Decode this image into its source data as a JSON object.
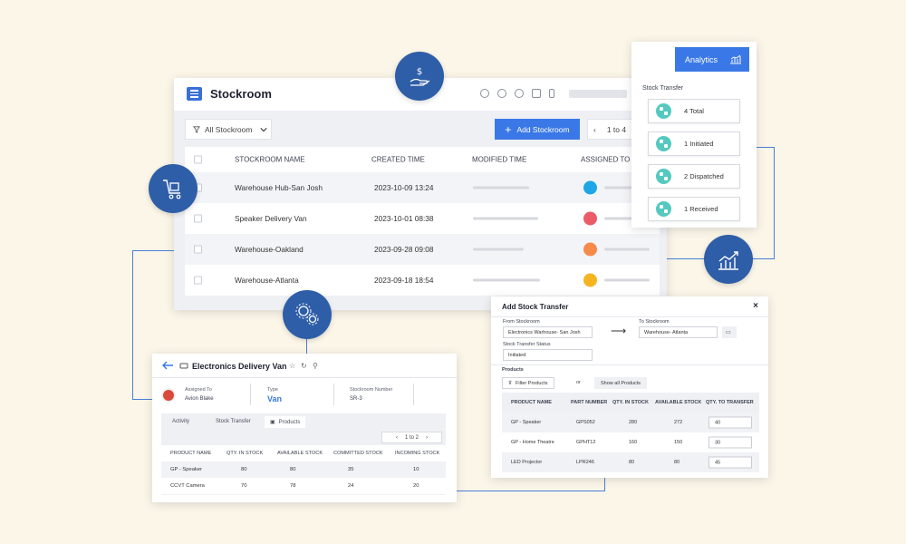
{
  "main": {
    "title": "Stockroom",
    "filter_label": "All Stockroom",
    "add_button": "Add Stockroom",
    "pager": "1 to 4",
    "columns": [
      "STOCKROOM NAME",
      "CREATED TIME",
      "MODIFIED TIME",
      "ASSIGNED TO"
    ],
    "rows": [
      {
        "name": "Warehouse Hub-San Josh",
        "created": "2023-10-09 13:24",
        "color": "#1ea7e4"
      },
      {
        "name": "Speaker Delivery Van",
        "created": "2023-10-01 08:38",
        "color": "#ec5b68"
      },
      {
        "name": "Warehouse-Oakland",
        "created": "2023-09-28 09:08",
        "color": "#f58a4b"
      },
      {
        "name": "Warehouse-Atlanta",
        "created": "2023-09-18 18:54",
        "color": "#f5b521"
      }
    ]
  },
  "transfer": {
    "analytics_button": "Analytics",
    "label": "Stock Transfer",
    "items": [
      "4 Total",
      "1 Initiated",
      "2 Dispatched",
      "1 Received"
    ]
  },
  "electronics": {
    "title": "Electronics Delivery Van",
    "assigned_label": "Assigned To",
    "assigned_value": "Avion Blake",
    "type_label": "Type",
    "type_value": "Van",
    "number_label": "Stockroom Number",
    "number_value": "SR-3",
    "tabs": [
      "Activity",
      "Stock Transfer",
      "Products"
    ],
    "pager": "1 to 2",
    "columns": [
      "PRODUCT NAME",
      "QTY. IN STOCK",
      "AVAILABLE STOCK",
      "COMMITTED STOCK",
      "INCOMING STOCK"
    ],
    "rows": [
      [
        "GP - Speaker",
        "80",
        "80",
        "35",
        "10"
      ],
      [
        "CCVT Camera",
        "70",
        "78",
        "24",
        "20"
      ]
    ]
  },
  "dialog": {
    "title": "Add Stock Transfer",
    "close": "×",
    "from_label": "From Stockroom",
    "from_value": "Electronics Warhouse- San Josh",
    "to_label": "To Stockroom",
    "to_value": "Warehouse- Atlanta",
    "status_label": "Stock Transfer Status",
    "status_value": "Initiated",
    "products_label": "Products",
    "filter_button": "Filter Products",
    "or": "or",
    "show_all": "Show all Products",
    "columns": [
      "PRODUCT NAME",
      "PART NUMBER",
      "QTY. IN STOCK",
      "AVAILABLE STOCK",
      "QTY. TO TRANSFER"
    ],
    "rows": [
      [
        "GP - Speaker",
        "GPS052",
        "280",
        "272",
        "40"
      ],
      [
        "GP - Home Theatre",
        "GPHT12",
        "160",
        "150",
        "30"
      ],
      [
        "LED Projector",
        "LPR246",
        "80",
        "80",
        "45"
      ]
    ]
  },
  "colors": {
    "accent": "#3b78e7",
    "circle": "#2f5ea8",
    "teal": "#55c9c0",
    "background": "#fbf6e8"
  }
}
